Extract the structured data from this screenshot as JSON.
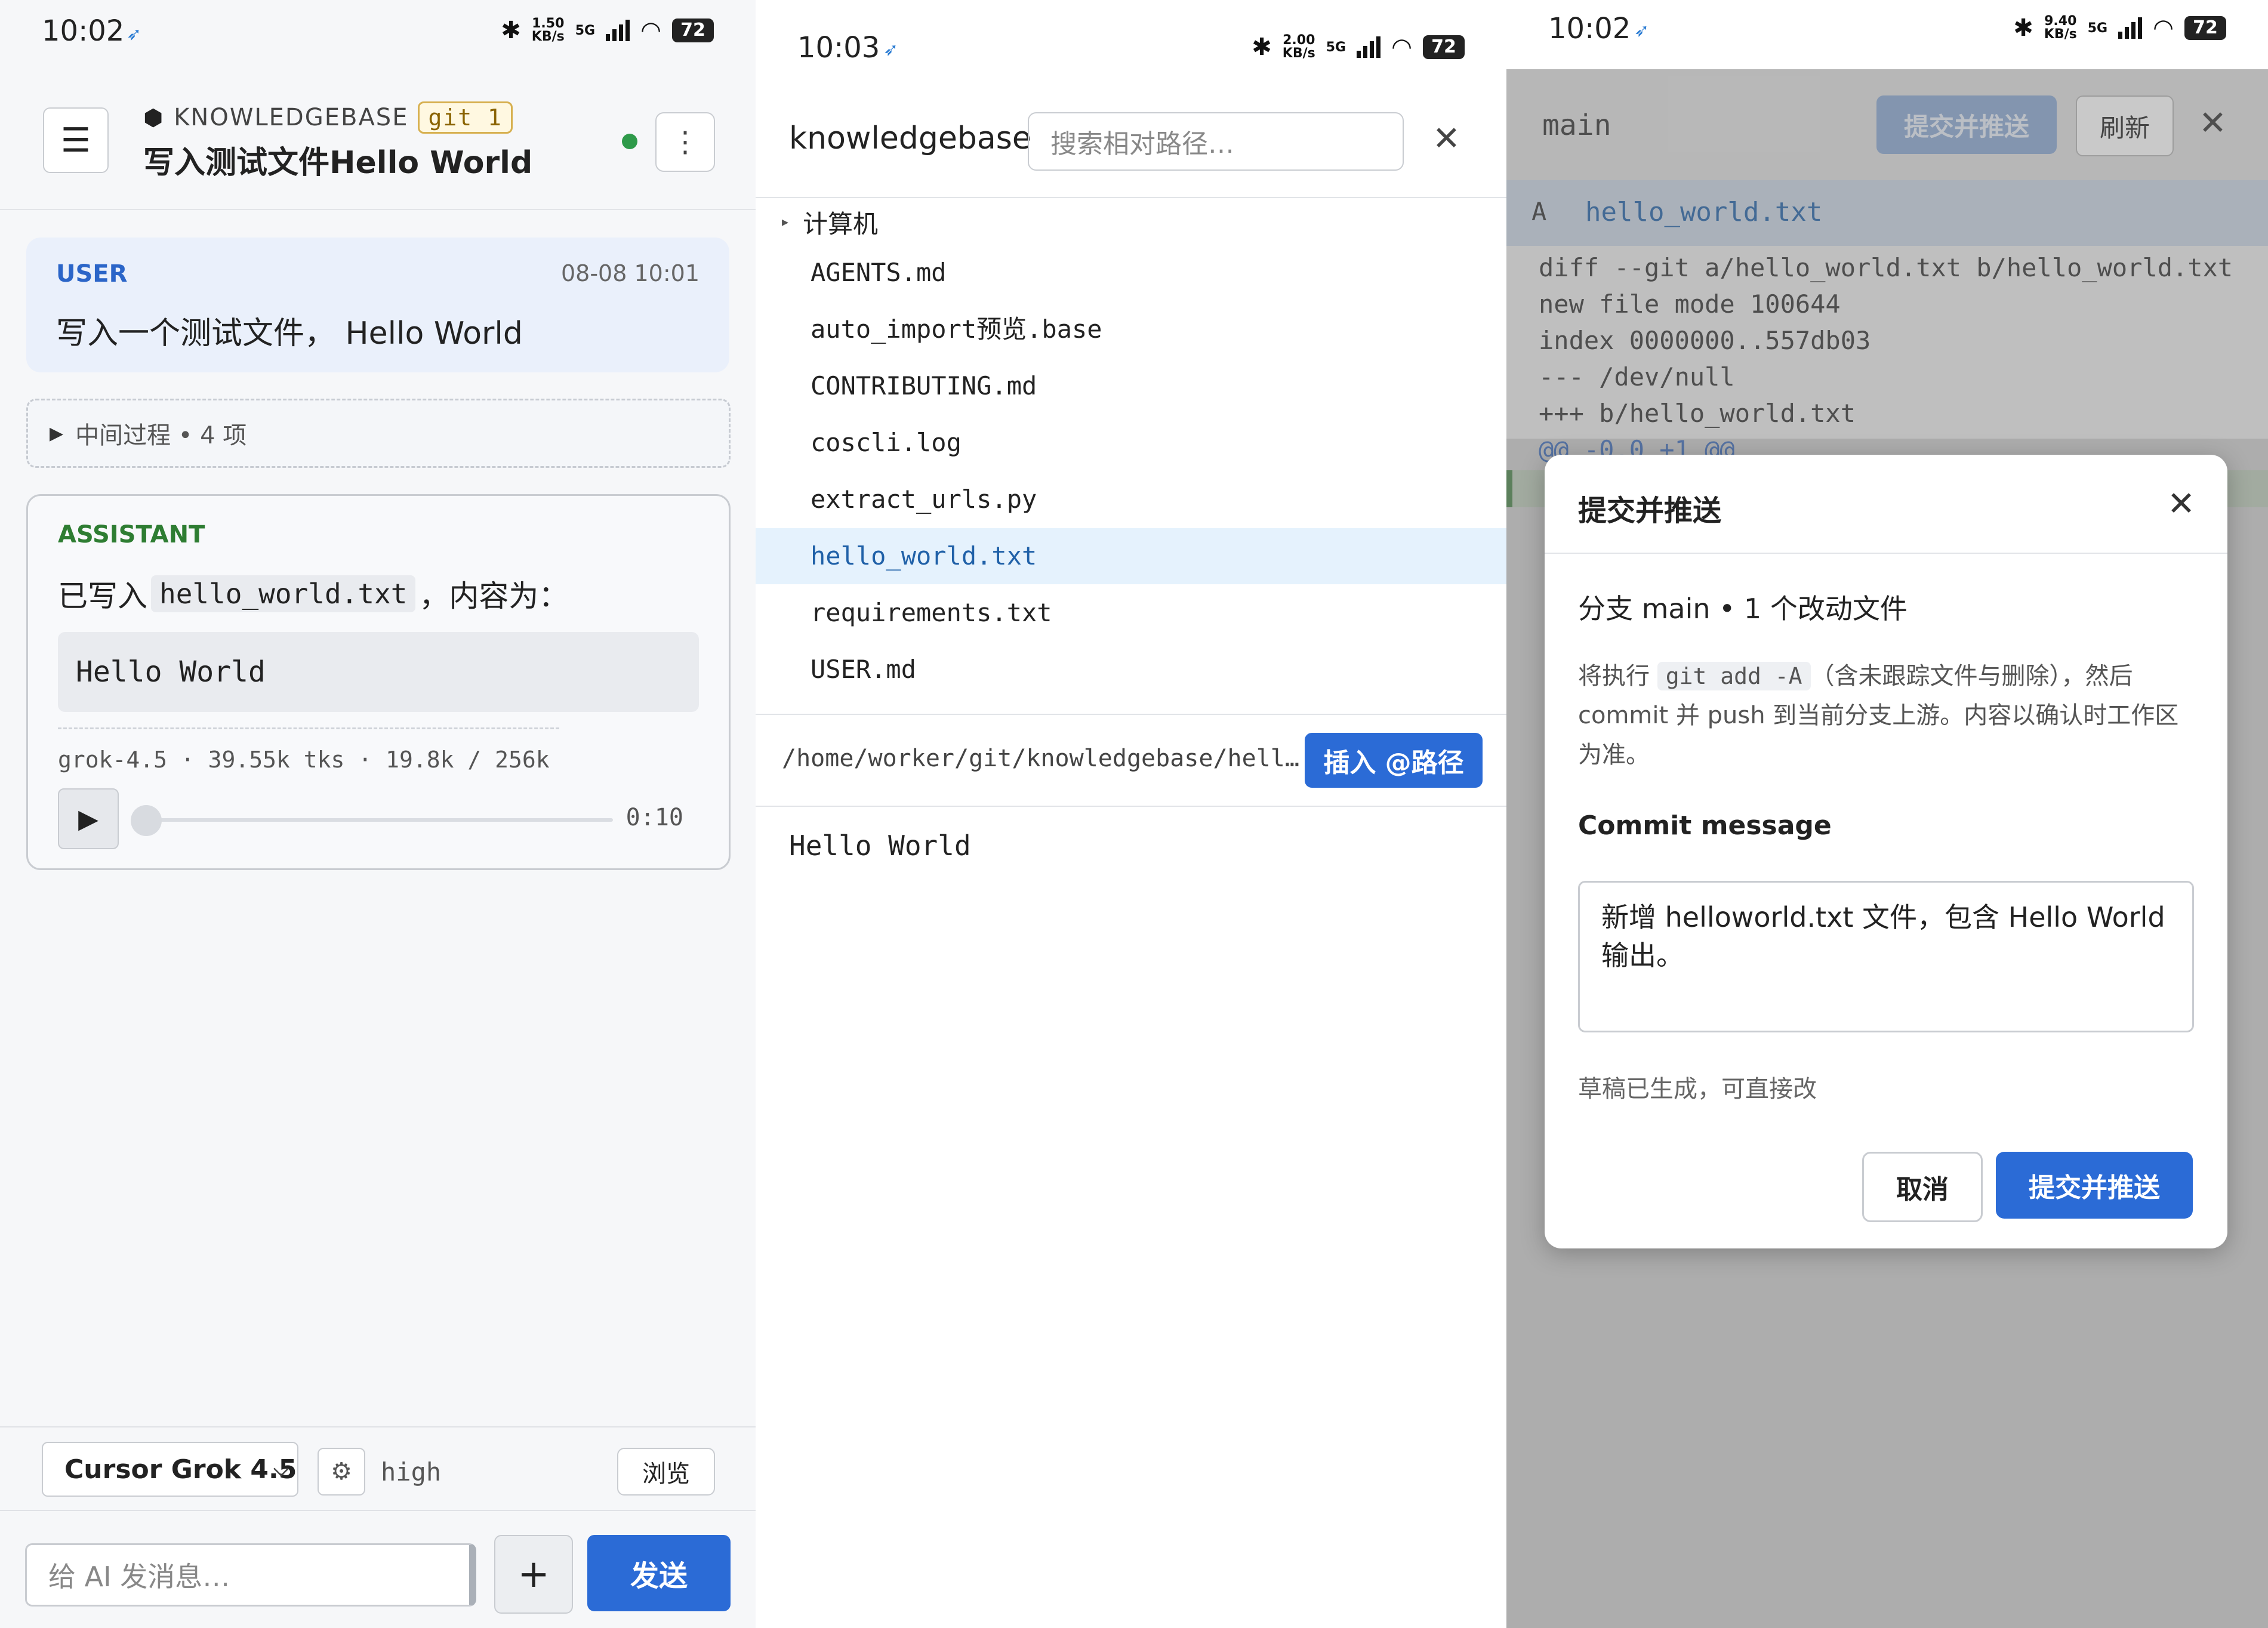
{
  "panel1": {
    "status": {
      "time": "10:02",
      "speed_top": "1.50",
      "speed_unit": "KB/s",
      "net": "5G",
      "battery": "72"
    },
    "header": {
      "repo": "KNOWLEDGEBASE",
      "git_badge": "git 1",
      "title": "写入测试文件Hello World"
    },
    "user_msg": {
      "role": "USER",
      "time": "08-08 10:01",
      "text": "写入一个测试文件， Hello World"
    },
    "process": {
      "label": "中间过程 • 4 项"
    },
    "assistant": {
      "role": "ASSISTANT",
      "prefix": "已写入",
      "filename": "hello_world.txt",
      "suffix": "，内容为：",
      "code": "Hello World",
      "meta": "grok-4.5 · 39.55k tks · 19.8k / 256k",
      "duration": "0:10",
      "progress": 0
    },
    "controls": {
      "model": "Cursor Grok 4.5",
      "effort": "high",
      "browse": "浏览"
    },
    "input": {
      "placeholder": "给 AI 发消息…",
      "plus": "+",
      "send": "发送"
    }
  },
  "panel2": {
    "status": {
      "time": "10:03",
      "speed_top": "2.00",
      "speed_unit": "KB/s",
      "net": "5G",
      "battery": "72"
    },
    "title": "knowledgebase",
    "search_placeholder": "搜索相对路径…",
    "folder": "计算机",
    "files": [
      "AGENTS.md",
      "auto_import预览.base",
      "CONTRIBUTING.md",
      "coscli.log",
      "extract_urls.py",
      "hello_world.txt",
      "requirements.txt",
      "USER.md"
    ],
    "selected_index": 5,
    "path": "/home/worker/git/knowledgebase/hell…",
    "insert_btn": "插入 @路径",
    "content": "Hello World"
  },
  "panel3": {
    "status": {
      "time": "10:02",
      "speed_top": "9.40",
      "speed_unit": "KB/s",
      "net": "5G",
      "battery": "72"
    },
    "branch": "main",
    "commit_push": "提交并推送",
    "refresh": "刷新",
    "file_status": "A",
    "file_name": "hello_world.txt",
    "diff_lines": [
      "diff --git a/hello_world.txt b/hello_world.txt",
      "new file mode 100644",
      "index 0000000..557db03",
      "--- /dev/null",
      "+++ b/hello_world.txt"
    ],
    "diff_hunk": "@@ -0,0 +1 @@",
    "modal": {
      "title": "提交并推送",
      "sub": "分支 main • 1 个改动文件",
      "desc_pre": "将执行",
      "desc_code": "git add -A",
      "desc_post": "（含未跟踪文件与删除），然后 commit 并 push 到当前分支上游。内容以确认时工作区为准。",
      "commit_label": "Commit message",
      "commit_text": "新增 helloworld.txt 文件，包含 Hello World 输出。",
      "draft_note": "草稿已生成，可直接改",
      "cancel": "取消",
      "confirm": "提交并推送"
    }
  }
}
